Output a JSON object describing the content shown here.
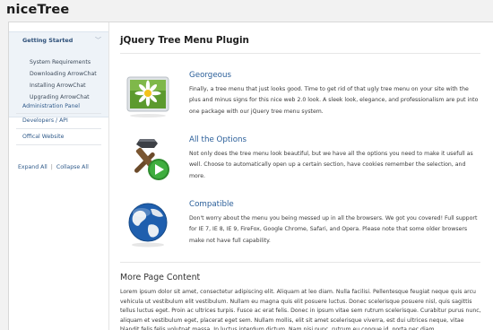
{
  "app": {
    "logo": "niceTree"
  },
  "sidebar": {
    "section": {
      "header": "Getting Started",
      "arrow": "﹀",
      "items": [
        {
          "label": "System Requirements"
        },
        {
          "label": "Downloading ArrowChat"
        },
        {
          "label": "Installing ArrowChat"
        },
        {
          "label": "Upgrading ArrowChat"
        }
      ]
    },
    "links": [
      {
        "label": "Administration Panel"
      },
      {
        "label": "Developers / API"
      },
      {
        "label": "Offical Website"
      }
    ],
    "expand_all": "Expand All",
    "separator": "|",
    "collapse_all": "Collapse All"
  },
  "main": {
    "title": "jQuery Tree Menu Plugin",
    "features": [
      {
        "title": "Georgeous",
        "icon": "daisy-photo-icon",
        "text": "Finally, a tree menu that just looks good. Time to get rid of that ugly tree menu on your site with the plus and minus signs for this nice web 2.0 look. A sleek look, elegance, and professionalism are put into one package with our jQuery tree menu system."
      },
      {
        "title": "All the Options",
        "icon": "hammer-play-icon",
        "text": "Not only does the tree menu look beautiful, but we have all the options you need to make it usefull as well. Choose to automatically open up a certain section, have cookies remember the selection, and more."
      },
      {
        "title": "Compatible",
        "icon": "globe-icon",
        "text": "Don't worry about the menu you being messed up in all the browsers. We got you covered! Full support for IE 7, IE 8, IE 9, FireFox, Google Chrome, Safari, and Opera. Please note that some older browsers make not have full capability."
      }
    ],
    "more_title": "More Page Content",
    "more_text": "Lorem ipsum dolor sit amet, consectetur adipiscing elit. Aliquam at leo diam. Nulla facilisi. Pellentesque feugiat neque quis arcu vehicula ut vestibulum elit vestibulum. Nullam eu magna quis elit posuere luctus. Donec scelerisque posuere nisl, quis sagittis tellus luctus eget. Proin ac ultrices turpis. Fusce ac erat felis. Donec in ipsum vitae sem rutrum scelerisque. Curabitur purus nunc, aliquam et vestibulum eget, placerat eget sem. Nullam mollis, elit sit amet scelerisque viverra, est dui ultrices neque, vitae blandit felis felis volutpat massa. In luctus interdum dictum. Nam nisi nunc, rutrum eu congue id, porta nec diam."
  },
  "colors": {
    "accent": "#2b5f9a",
    "sidebar_bg": "#eef3f8",
    "link": "#2f5a8a"
  }
}
